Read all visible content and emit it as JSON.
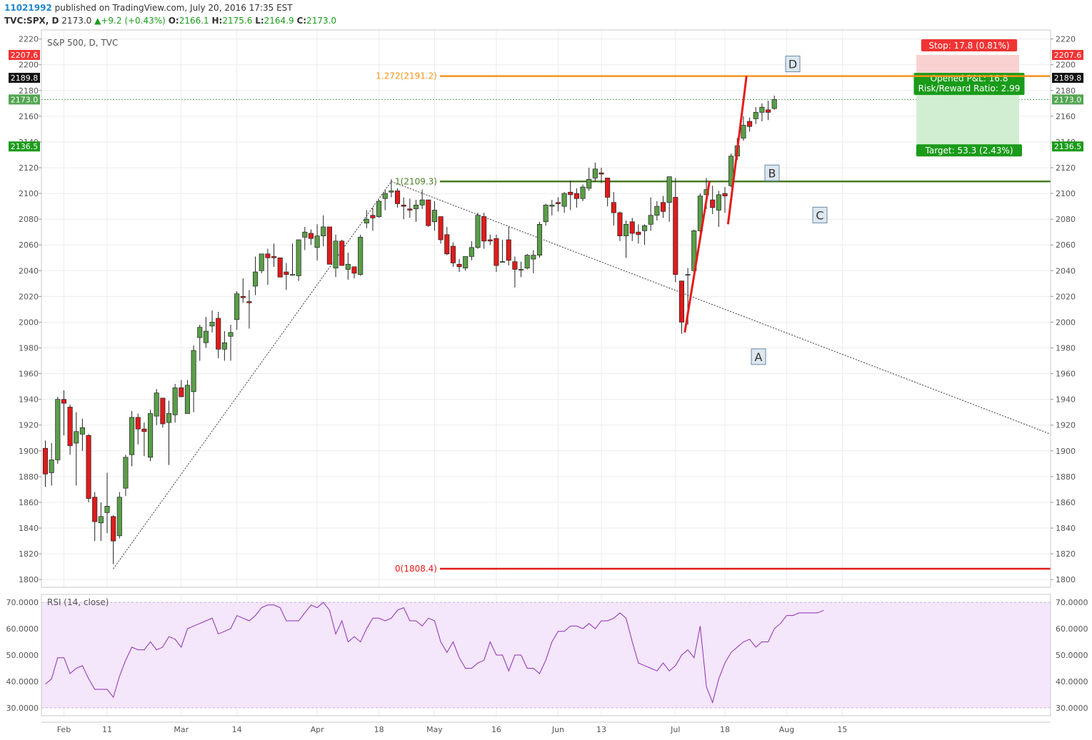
{
  "header": {
    "publish_id": "11021992",
    "publish_text": " published on TradingView.com, July 20, 2016 17:35 EST",
    "symbol": "TVC:SPX, D",
    "last": "2173.0",
    "change": "+9.2 (+0.43%)",
    "o_label": "O:",
    "o_value": "2166.1",
    "h_label": "H:",
    "h_value": "2175.6",
    "l_label": "L:",
    "l_value": "2164.9",
    "c_label": "C:",
    "c_value": "2173.0"
  },
  "chart_data": {
    "type": "candlestick",
    "title": "S&P 500, D, TVC",
    "ylim": [
      1794,
      2227
    ],
    "yticks": [
      1800,
      1820,
      1840,
      1860,
      1880,
      1900,
      1920,
      1940,
      1960,
      1980,
      2000,
      2020,
      2040,
      2060,
      2080,
      2100,
      2120,
      2140,
      2160,
      2180,
      2200,
      2220
    ],
    "xticks": [
      {
        "label": "Feb",
        "bar": 3
      },
      {
        "label": "11",
        "bar": 10
      },
      {
        "label": "Mar",
        "bar": 22
      },
      {
        "label": "14",
        "bar": 31
      },
      {
        "label": "Apr",
        "bar": 44
      },
      {
        "label": "18",
        "bar": 54
      },
      {
        "label": "May",
        "bar": 63
      },
      {
        "label": "16",
        "bar": 73
      },
      {
        "label": "Jun",
        "bar": 83
      },
      {
        "label": "13",
        "bar": 90
      },
      {
        "label": "Jul",
        "bar": 102
      },
      {
        "label": "18",
        "bar": 110
      },
      {
        "label": "Aug",
        "bar": 120
      },
      {
        "label": "15",
        "bar": 129
      }
    ],
    "candles": [
      [
        1902,
        1882,
        1908,
        1872
      ],
      [
        1883,
        1893,
        1906,
        1873
      ],
      [
        1893,
        1940,
        1942,
        1890
      ],
      [
        1940,
        1937,
        1947,
        1912
      ],
      [
        1934,
        1904,
        1936,
        1897
      ],
      [
        1906,
        1915,
        1930,
        1873
      ],
      [
        1913,
        1918,
        1925,
        1900
      ],
      [
        1912,
        1863,
        1913,
        1860
      ],
      [
        1864,
        1845,
        1868,
        1830
      ],
      [
        1844,
        1849,
        1860,
        1830
      ],
      [
        1852,
        1857,
        1883,
        1836
      ],
      [
        1849,
        1830,
        1850,
        1812
      ],
      [
        1834,
        1864,
        1868,
        1832
      ],
      [
        1871,
        1895,
        1897,
        1865
      ],
      [
        1897,
        1926,
        1931,
        1888
      ],
      [
        1926,
        1917,
        1929,
        1905
      ],
      [
        1917,
        1915,
        1922,
        1896
      ],
      [
        1895,
        1929,
        1932,
        1892
      ],
      [
        1927,
        1945,
        1948,
        1920
      ],
      [
        1941,
        1921,
        1939,
        1918
      ],
      [
        1922,
        1929,
        1939,
        1889
      ],
      [
        1928,
        1949,
        1952,
        1922
      ],
      [
        1949,
        1942,
        1955,
        1942
      ],
      [
        1929,
        1951,
        1955,
        1929
      ],
      [
        1946,
        1978,
        1982,
        1930
      ],
      [
        1988,
        1996,
        1998,
        1970
      ],
      [
        1984,
        1993,
        2004,
        1980
      ],
      [
        1997,
        2000,
        2009,
        1992
      ],
      [
        2003,
        1979,
        2008,
        1972
      ],
      [
        1979,
        1984,
        1993,
        1970
      ],
      [
        1989,
        1992,
        1998,
        1970
      ],
      [
        2002,
        2022,
        2024,
        1994
      ],
      [
        2020,
        2019,
        2034,
        2015
      ],
      [
        2016,
        2015,
        2025,
        1995
      ],
      [
        2028,
        2039,
        2051,
        2021
      ],
      [
        2040,
        2053,
        2053,
        2038
      ],
      [
        2053,
        2050,
        2057,
        2029
      ],
      [
        2051,
        2050,
        2061,
        2043
      ],
      [
        2050,
        2035,
        2050,
        2035
      ],
      [
        2039,
        2037,
        2046,
        2025
      ],
      [
        2037,
        2037,
        2061,
        2036
      ],
      [
        2036,
        2064,
        2064,
        2032
      ],
      [
        2066,
        2070,
        2074,
        2056
      ],
      [
        2069,
        2065,
        2072,
        2060
      ],
      [
        2058,
        2067,
        2076,
        2048
      ],
      [
        2067,
        2074,
        2083,
        2059
      ],
      [
        2074,
        2045,
        2067,
        2045
      ],
      [
        2042,
        2063,
        2068,
        2035
      ],
      [
        2063,
        2044,
        2064,
        2044
      ],
      [
        2041,
        2045,
        2054,
        2033
      ],
      [
        2043,
        2038,
        2042,
        2034
      ],
      [
        2037,
        2066,
        2068,
        2036
      ],
      [
        2077,
        2080,
        2087,
        2073
      ],
      [
        2083,
        2081,
        2089,
        2071
      ],
      [
        2082,
        2094,
        2095,
        2081
      ],
      [
        2096,
        2100,
        2103,
        2087
      ],
      [
        2101,
        2102,
        2111,
        2097
      ],
      [
        2102,
        2092,
        2104,
        2089
      ],
      [
        2091,
        2090,
        2097,
        2080
      ],
      [
        2088,
        2087,
        2096,
        2081
      ],
      [
        2088,
        2091,
        2095,
        2078
      ],
      [
        2091,
        2095,
        2103,
        2088
      ],
      [
        2095,
        2075,
        2095,
        2074
      ],
      [
        2078,
        2087,
        2094,
        2071
      ],
      [
        2082,
        2064,
        2082,
        2061
      ],
      [
        2068,
        2053,
        2074,
        2052
      ],
      [
        2059,
        2046,
        2062,
        2043
      ],
      [
        2045,
        2043,
        2049,
        2039
      ],
      [
        2042,
        2051,
        2051,
        2040
      ],
      [
        2051,
        2058,
        2063,
        2048
      ],
      [
        2058,
        2083,
        2085,
        2057
      ],
      [
        2082,
        2063,
        2085,
        2057
      ],
      [
        2064,
        2063,
        2068,
        2060
      ],
      [
        2065,
        2044,
        2068,
        2039
      ],
      [
        2047,
        2047,
        2064,
        2047
      ],
      [
        2064,
        2048,
        2074,
        2044
      ],
      [
        2047,
        2041,
        2051,
        2027
      ],
      [
        2041,
        2041,
        2047,
        2035
      ],
      [
        2042,
        2052,
        2053,
        2041
      ],
      [
        2049,
        2052,
        2056,
        2038
      ],
      [
        2052,
        2076,
        2078,
        2050
      ],
      [
        2078,
        2091,
        2092,
        2075
      ],
      [
        2090,
        2091,
        2095,
        2083
      ],
      [
        2093,
        2092,
        2097,
        2086
      ],
      [
        2090,
        2100,
        2101,
        2085
      ],
      [
        2101,
        2099,
        2110,
        2087
      ],
      [
        2100,
        2096,
        2104,
        2089
      ],
      [
        2096,
        2105,
        2107,
        2094
      ],
      [
        2104,
        2111,
        2120,
        2102
      ],
      [
        2112,
        2119,
        2124,
        2109
      ],
      [
        2116,
        2115,
        2120,
        2108
      ],
      [
        2112,
        2097,
        2112,
        2090
      ],
      [
        2093,
        2085,
        2101,
        2075
      ],
      [
        2085,
        2067,
        2086,
        2063
      ],
      [
        2067,
        2076,
        2079,
        2050
      ],
      [
        2078,
        2069,
        2081,
        2063
      ],
      [
        2070,
        2068,
        2076,
        2061
      ],
      [
        2071,
        2075,
        2076,
        2060
      ],
      [
        2076,
        2083,
        2097,
        2071
      ],
      [
        2083,
        2090,
        2094,
        2079
      ],
      [
        2093,
        2086,
        2098,
        2081
      ],
      [
        2093,
        2113,
        2113,
        2078
      ],
      [
        2097,
        2037,
        2112,
        2031
      ],
      [
        2032,
        2000,
        2032,
        1991
      ],
      [
        2037,
        2037,
        2042,
        1998
      ],
      [
        2040,
        2071,
        2072,
        2039
      ],
      [
        2071,
        2098,
        2100,
        2068
      ],
      [
        2099,
        2103,
        2112,
        2088
      ],
      [
        2095,
        2089,
        2106,
        2084
      ],
      [
        2087,
        2099,
        2102,
        2074
      ],
      [
        2100,
        2098,
        2105,
        2085
      ],
      [
        2106,
        2129,
        2131,
        2105
      ],
      [
        2129,
        2137,
        2143,
        2126
      ],
      [
        2143,
        2153,
        2160,
        2141
      ],
      [
        2156,
        2152,
        2159,
        2148
      ],
      [
        2158,
        2163,
        2167,
        2154
      ],
      [
        2163,
        2167,
        2170,
        2156
      ],
      [
        2165,
        2163,
        2172,
        2157
      ],
      [
        2166,
        2173,
        2176,
        2165
      ]
    ],
    "fib_levels": [
      {
        "label": "1.272(2191.2)",
        "value": 2191.2,
        "color": "#f7931a"
      },
      {
        "label": "1(2109.3)",
        "value": 2109.3,
        "color": "#4a7a25"
      },
      {
        "label": "0(1808.4)",
        "value": 1808.4,
        "color": "#e61a1a"
      }
    ],
    "price_badges": [
      {
        "label": "2207.6",
        "value": 2207.6,
        "color": "#f03434"
      },
      {
        "label": "2189.8",
        "value": 2189.8,
        "color": "#111111"
      },
      {
        "label": "2173.0",
        "value": 2173.0,
        "color": "#53a553"
      },
      {
        "label": "2136.5",
        "value": 2136.5,
        "color": "#1a9b1a"
      }
    ],
    "position": {
      "stop_label": "Stop: 17.8 (0.81%)",
      "pnl_label": "Opened P&L: 16.8",
      "rr_label": "Risk/Reward Ratio: 2.99",
      "target_label": "Target: 53.3 (2.43%)",
      "entry": 2189.8,
      "stop": 2207.6,
      "target": 2136.5
    },
    "pattern_points": [
      {
        "label": "A",
        "value": 1992
      },
      {
        "label": "B",
        "value": 2109.3
      },
      {
        "label": "C",
        "value": 2076
      },
      {
        "label": "D",
        "value": 2191.2
      }
    ],
    "rsi": {
      "label": "RSI (14, close)",
      "ylim": [
        27,
        73
      ],
      "yticks": [
        {
          "value": 30,
          "label": "30.0000"
        },
        {
          "value": 40,
          "label": "40.0000"
        },
        {
          "value": 50,
          "label": "50.0000"
        },
        {
          "value": 60,
          "label": "60.0000"
        },
        {
          "value": 70,
          "label": "70.0000"
        }
      ],
      "values": [
        39,
        41,
        49,
        49,
        43,
        45,
        46,
        41,
        37,
        37,
        37,
        34,
        42,
        48,
        53,
        52,
        52,
        55,
        52,
        53,
        57,
        56,
        53,
        60,
        61,
        62,
        63,
        64,
        58,
        59,
        60,
        65,
        64,
        63,
        65,
        68,
        69,
        69,
        68,
        63,
        63,
        63,
        66,
        69,
        68,
        70,
        67,
        58,
        63,
        55,
        57,
        55,
        60,
        64,
        64,
        63,
        64,
        67,
        68,
        63,
        63,
        61,
        64,
        63,
        55,
        51,
        55,
        49,
        45,
        45,
        47,
        48,
        55,
        50,
        50,
        44,
        50,
        50,
        45,
        45,
        43,
        48,
        55,
        59,
        59,
        61,
        61,
        60,
        62,
        60,
        63,
        63,
        64,
        66,
        64,
        55,
        47,
        46,
        45,
        44,
        47,
        44,
        46,
        50,
        52,
        49,
        61,
        38,
        32,
        41,
        47,
        51,
        53,
        55,
        56,
        53,
        55,
        55,
        60,
        62,
        65,
        65,
        66,
        66,
        66,
        66,
        67
      ]
    }
  }
}
